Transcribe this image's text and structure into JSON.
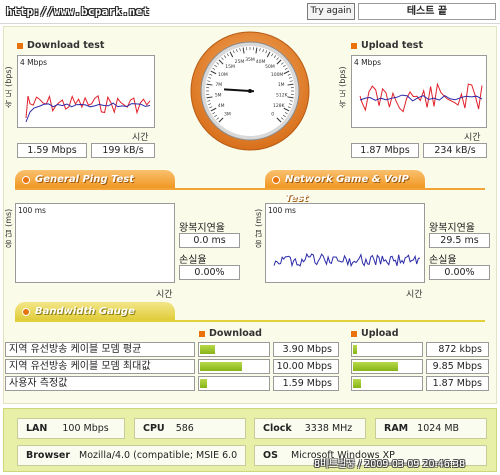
{
  "header": {
    "url": "http://www.bcpark.net",
    "try_again": "Try again",
    "status": "테스트 끝"
  },
  "download": {
    "title": "Download test",
    "y_label": "속 도 (bps)",
    "scale": "4 Mbps",
    "time_label": "시간",
    "mbps": "1.59 Mbps",
    "kbs": "199 kB/s"
  },
  "upload": {
    "title": "Upload test",
    "y_label": "속 도 (bps)",
    "scale": "4 Mbps",
    "time_label": "시간",
    "mbps": "1.87 Mbps",
    "kbs": "234 kB/s"
  },
  "ping": {
    "tab_label": "General Ping Test",
    "y_label": "응 답 (ms)",
    "scale": "100 ms",
    "time_label": "시간",
    "latency_label": "왕복지연율",
    "latency_value": "0.0 ms",
    "loss_label": "손실율",
    "loss_value": "0.00%"
  },
  "game": {
    "tab_label": "Network Game & VoIP Test",
    "y_label": "응 답 (ms)",
    "scale": "100 ms",
    "time_label": "시간",
    "latency_label": "왕복지연율",
    "latency_value": "29.5 ms",
    "loss_label": "손실율",
    "loss_value": "0.00%"
  },
  "bandwidth": {
    "tab_label": "Bandwidth Gauge",
    "download_header": "Download",
    "upload_header": "Upload",
    "rows": [
      {
        "label": "지역 유선방송 케이블 모뎀 평균",
        "down_value": "3.90 Mbps",
        "down_fill": 0.22,
        "up_value": "872 kbps",
        "up_fill": 0.06
      },
      {
        "label": "지역 유선방송 케이블 모뎀 최대값",
        "down_value": "10.00 Mbps",
        "down_fill": 0.62,
        "up_value": "9.85 Mbps",
        "up_fill": 0.66
      },
      {
        "label": "사용자 측정값",
        "down_value": "1.59 Mbps",
        "down_fill": 0.1,
        "up_value": "1.87 Mbps",
        "up_fill": 0.12
      }
    ]
  },
  "system": {
    "lan_key": "LAN",
    "lan_value": "100 Mbps",
    "cpu_key": "CPU",
    "cpu_value": "586",
    "clock_key": "Clock",
    "clock_value": "3338 MHz",
    "ram_key": "RAM",
    "ram_value": "1024 MB",
    "browser_key": "Browser",
    "browser_value": "Mozilla/4.0 (compatible; MSIE 6.0",
    "os_key": "OS",
    "os_value": "Microsoft Windows XP"
  },
  "watermark": "8비트벌꿍 / 2009-03-09 20:46:38",
  "gauge": {
    "ticks": [
      "3M",
      "4M",
      "5M",
      "7M",
      "10M",
      "15M",
      "25M",
      "35M",
      "40M",
      "50M",
      "100M",
      "1M",
      "512K",
      "128K",
      "0"
    ],
    "value_fraction": 0.18
  },
  "colors": {
    "accent_orange": "#e8730c",
    "download_line_red": "#e0202a",
    "download_line_blue": "#2a2aa8",
    "ping_line_blue": "#2a2aa8",
    "bar_green": "#87b418",
    "panel_bg": "#fbfbea",
    "info_bg": "#e8f0a8"
  }
}
